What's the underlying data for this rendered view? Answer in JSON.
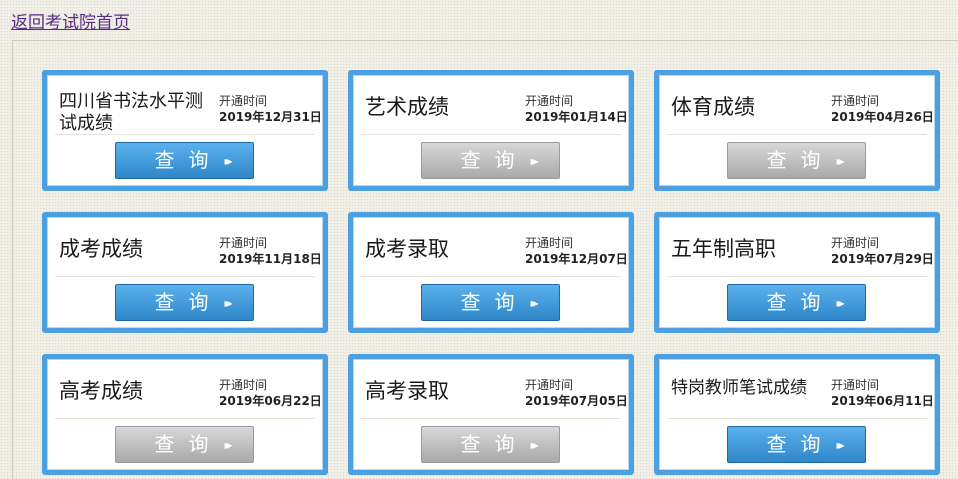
{
  "back_link": "返回考试院首页",
  "cards": [
    {
      "title": "四川省书法水平测试成绩",
      "open_label": "开通时间",
      "open_date": "2019年12月31日",
      "button": "查询",
      "enabled": true
    },
    {
      "title": "艺术成绩",
      "open_label": "开通时间",
      "open_date": "2019年01月14日",
      "button": "查询",
      "enabled": false
    },
    {
      "title": "体育成绩",
      "open_label": "开通时间",
      "open_date": "2019年04月26日",
      "button": "查询",
      "enabled": false
    },
    {
      "title": "成考成绩",
      "open_label": "开通时间",
      "open_date": "2019年11月18日",
      "button": "查询",
      "enabled": true
    },
    {
      "title": "成考录取",
      "open_label": "开通时间",
      "open_date": "2019年12月07日",
      "button": "查询",
      "enabled": true
    },
    {
      "title": "五年制高职",
      "open_label": "开通时间",
      "open_date": "2019年07月29日",
      "button": "查询",
      "enabled": true
    },
    {
      "title": "高考成绩",
      "open_label": "开通时间",
      "open_date": "2019年06月22日",
      "button": "查询",
      "enabled": false
    },
    {
      "title": "高考录取",
      "open_label": "开通时间",
      "open_date": "2019年07月05日",
      "button": "查询",
      "enabled": false
    },
    {
      "title": "特岗教师笔试成绩",
      "open_label": "开通时间",
      "open_date": "2019年06月11日",
      "button": "查询",
      "enabled": true
    }
  ],
  "colors": {
    "accent": "#4c9fe0",
    "button_active": "#2f86c9",
    "button_disabled": "#a9a9a9",
    "link": "#5a2a86"
  },
  "icons": {
    "button_arrow": "double-chevron-right-icon"
  }
}
